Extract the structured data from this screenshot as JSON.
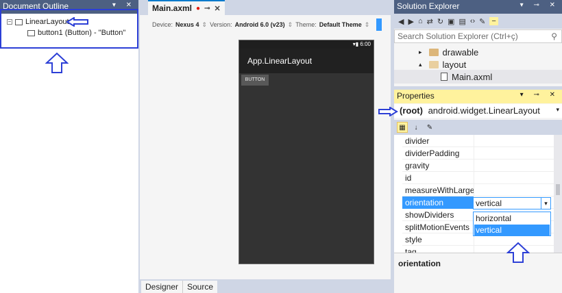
{
  "document_outline": {
    "title": "Document Outline",
    "nodes": [
      {
        "expander": "−",
        "label": "LinearLayout"
      },
      {
        "label": "button1 (Button) - \"Button\""
      }
    ]
  },
  "designer": {
    "tab_title": "Main.axml",
    "devbar": {
      "device_label": "Device:",
      "device_value": "Nexus 4",
      "version_label": "Version:",
      "version_value": "Android 6.0 (v23)",
      "theme_label": "Theme:",
      "theme_value": "Default Theme"
    },
    "phone": {
      "status_time": "6:00",
      "app_title": "App.LinearLayout",
      "button_text": "BUTTON"
    },
    "bottom_tabs": [
      "Designer",
      "Source"
    ]
  },
  "solution_explorer": {
    "title": "Solution Explorer",
    "search_placeholder": "Search Solution Explorer (Ctrl+ç)",
    "items": [
      {
        "expander": "▸",
        "label": "drawable"
      },
      {
        "expander": "▴",
        "label": "layout"
      },
      {
        "label": "Main.axml"
      }
    ]
  },
  "properties": {
    "title": "Properties",
    "object_label": "(root)",
    "object_type": "android.widget.LinearLayout",
    "rows": [
      "divider",
      "dividerPadding",
      "gravity",
      "id",
      "measureWithLargest",
      "orientation",
      "showDividers",
      "splitMotionEvents",
      "style",
      "tag"
    ],
    "orientation_value": "vertical",
    "dropdown_options": [
      "horizontal",
      "vertical"
    ],
    "description": "orientation"
  },
  "colors": {
    "accent": "#2c3fd6",
    "selection": "#3399ff",
    "active_header": "#fff29d"
  }
}
